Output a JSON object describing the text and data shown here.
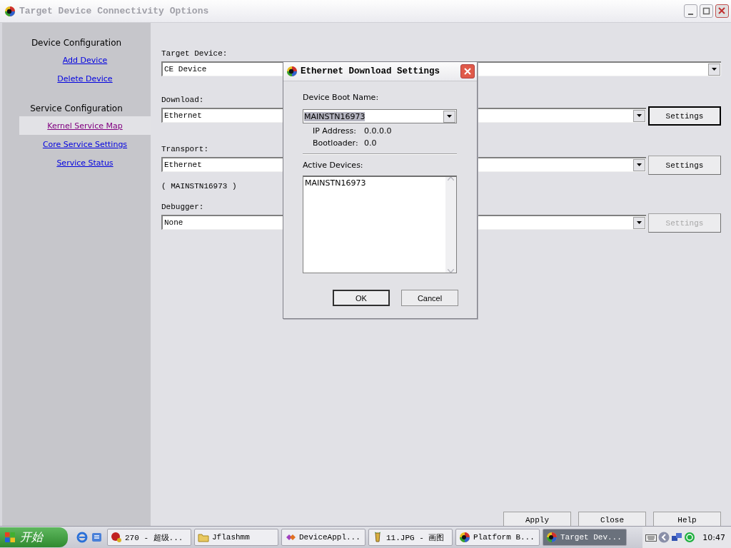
{
  "window": {
    "title": "Target Device Connectivity Options"
  },
  "sidebar": {
    "sections": [
      {
        "heading": "Device Configuration",
        "items": [
          {
            "label": "Add Device",
            "selected": false
          },
          {
            "label": "Delete Device",
            "selected": false
          }
        ]
      },
      {
        "heading": "Service Configuration",
        "items": [
          {
            "label": "Kernel Service Map",
            "selected": true
          },
          {
            "label": "Core Service Settings",
            "selected": false
          },
          {
            "label": "Service Status",
            "selected": false
          }
        ]
      }
    ]
  },
  "fields": [
    {
      "label": "Target Device:",
      "value": "CE Device"
    },
    {
      "label": "Download:",
      "value": "Ethernet",
      "settings_button": {
        "label": "Settings",
        "disabled": false,
        "focused": true
      }
    },
    {
      "label": "Transport:",
      "value": "Ethernet",
      "note": "( MAINSTN16973 )",
      "settings_button": {
        "label": "Settings",
        "disabled": false,
        "focused": false
      }
    },
    {
      "label": "Debugger:",
      "value": "None",
      "settings_button": {
        "label": "Settings",
        "disabled": true,
        "focused": false
      }
    }
  ],
  "buttons": [
    "Apply",
    "Close",
    "Help"
  ],
  "dialog": {
    "title": "Ethernet Download Settings",
    "boot_name_label": "Device Boot Name:",
    "boot_name": "MAINSTN16973",
    "ip_label": "IP Address:",
    "ip": "0.0.0.0",
    "bootloader_label": "Bootloader:",
    "bootloader": "0.0",
    "active_label": "Active Devices:",
    "active_devices": [
      "MAINSTN16973"
    ],
    "buttons": [
      {
        "label": "OK",
        "default": true
      },
      {
        "label": "Cancel",
        "default": false
      }
    ]
  },
  "taskbar": {
    "start": "开始",
    "tasks": [
      {
        "label": "270 - 超级...",
        "kind": "app",
        "selected": false
      },
      {
        "label": "Jflashmm",
        "kind": "folder",
        "selected": false
      },
      {
        "label": "DeviceAppl...",
        "kind": "studio",
        "selected": false
      },
      {
        "label": "11.JPG - 画图",
        "kind": "paint",
        "selected": false
      },
      {
        "label": "Platform B...",
        "kind": "platform",
        "selected": false
      },
      {
        "label": "Target Dev...",
        "kind": "platform",
        "selected": true
      }
    ],
    "clock": "10:47"
  }
}
